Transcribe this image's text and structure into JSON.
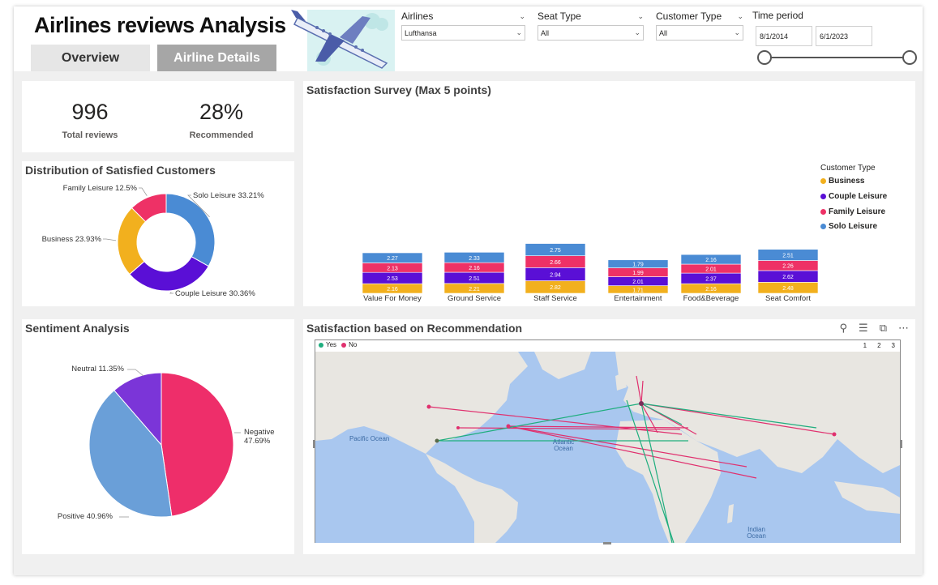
{
  "header": {
    "title": "Airlines reviews Analysis",
    "tabs": [
      {
        "label": "Overview"
      },
      {
        "label": "Airline Details"
      }
    ]
  },
  "slicers": {
    "airlines": {
      "label": "Airlines",
      "value": "Lufthansa"
    },
    "seat_type": {
      "label": "Seat Type",
      "value": "All"
    },
    "customer_type": {
      "label": "Customer Type",
      "value": "All"
    },
    "time_period": {
      "label": "Time period",
      "start": "8/1/2014",
      "end": "6/1/2023"
    }
  },
  "kpis": {
    "total_reviews": {
      "value": "996",
      "label": "Total reviews"
    },
    "recommended": {
      "value": "28%",
      "label": "Recommended"
    }
  },
  "colors": {
    "business": "#f2b01e",
    "couple": "#5a0fd6",
    "family": "#ee3166",
    "solo": "#4a8bd4",
    "negative": "#ee2e6a",
    "positive": "#6a9fd8",
    "neutral": "#7b35d8",
    "yes": "#1fae7e",
    "no": "#e0306e"
  },
  "distribution_panel": {
    "title": "Distribution of Satisfied Customers"
  },
  "survey_panel": {
    "title": "Satisfaction Survey (Max 5 points)",
    "legend_title": "Customer Type"
  },
  "sentiment_panel": {
    "title": "Sentiment Analysis"
  },
  "map_panel": {
    "title": "Satisfaction based on Recommendation",
    "legend": {
      "yes": "Yes",
      "no": "No"
    },
    "pages": [
      "1",
      "2",
      "3"
    ],
    "labels": {
      "pacific": "Pacific Ocean",
      "atlantic": "Atlantic Ocean",
      "indian": "Indian Ocean"
    },
    "icons": [
      "pin-icon",
      "filter-icon",
      "focus-mode-icon",
      "more-options-icon"
    ]
  },
  "chart_data": [
    {
      "type": "pie",
      "variant": "donut",
      "labels": [
        "Solo Leisure",
        "Couple Leisure",
        "Business",
        "Family Leisure"
      ],
      "values": [
        33.21,
        30.36,
        23.93,
        12.5
      ],
      "display_labels": [
        "Solo Leisure 33.21%",
        "Couple Leisure 30.36%",
        "Business 23.93%",
        "Family Leisure 12.5%"
      ]
    },
    {
      "type": "bar",
      "stacked": true,
      "categories": [
        "Value For Money",
        "Ground Service",
        "Staff Service",
        "Entertainment",
        "Food&Beverage",
        "Seat Comfort"
      ],
      "series": [
        {
          "name": "Business",
          "values": [
            2.16,
            2.21,
            2.82,
            1.71,
            2.16,
            2.48
          ]
        },
        {
          "name": "Couple Leisure",
          "values": [
            2.53,
            2.51,
            2.94,
            2.01,
            2.37,
            2.62
          ]
        },
        {
          "name": "Family Leisure",
          "values": [
            2.13,
            2.16,
            2.66,
            1.99,
            2.01,
            2.26
          ]
        },
        {
          "name": "Solo Leisure",
          "values": [
            2.27,
            2.33,
            2.75,
            1.79,
            2.16,
            2.51
          ]
        }
      ],
      "title": "Satisfaction Survey (Max 5 points)",
      "legend_title": "Customer Type",
      "legend_position": "right"
    },
    {
      "type": "pie",
      "labels": [
        "Negative",
        "Positive",
        "Neutral"
      ],
      "values": [
        47.69,
        40.96,
        11.35
      ],
      "display_labels": [
        "Negative 47.69%",
        "Positive 40.96%",
        "Neutral 11.35%"
      ]
    }
  ]
}
